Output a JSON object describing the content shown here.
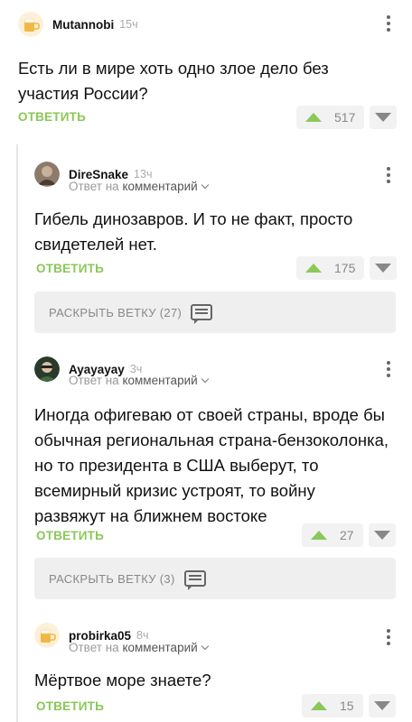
{
  "comments": [
    {
      "username": "Mutannobi",
      "time": "15ч",
      "text_lines": [
        "Есть ли в мире хоть одно злое дело без",
        "участия России?"
      ],
      "reply_label": "ОТВЕТИТЬ",
      "votes": "517",
      "avatar_icon": "beer-mug-icon"
    },
    {
      "username": "DireSnake",
      "time": "13ч",
      "reply_to_prefix": "Ответ на",
      "reply_to_target": "комментарий",
      "text_lines": [
        "Гибель динозавров. И то не факт, просто",
        "свидетелей нет."
      ],
      "reply_label": "ОТВЕТИТЬ",
      "votes": "175",
      "avatar_icon": "user-photo-icon"
    },
    {
      "username": "Ayayayay",
      "time": "3ч",
      "reply_to_prefix": "Ответ на",
      "reply_to_target": "комментарий",
      "text_lines": [
        "Иногда офигеваю от своей страны, вроде бы",
        "обычная региональная страна-бензоколонка,",
        "но то президента в США выберут, то",
        "всемирный кризис устроят, то войну",
        "развяжут на ближнем востоке"
      ],
      "reply_label": "ОТВЕТИТЬ",
      "votes": "27",
      "avatar_icon": "user-photo-icon"
    },
    {
      "username": "probirka05",
      "time": "8ч",
      "reply_to_prefix": "Ответ на",
      "reply_to_target": "комментарий",
      "text_lines": [
        "Мёртвое море знаете?"
      ],
      "reply_label": "ОТВЕТИТЬ",
      "votes": "15",
      "avatar_icon": "beer-mug-icon"
    }
  ],
  "expand_threads": [
    {
      "label": "РАСКРЫТЬ ВЕТКУ (27)"
    },
    {
      "label": "РАСКРЫТЬ ВЕТКУ (3)"
    }
  ],
  "colors": {
    "accent_green": "#8ac858",
    "muted_gray": "#888888",
    "expand_bg": "#efefef"
  }
}
